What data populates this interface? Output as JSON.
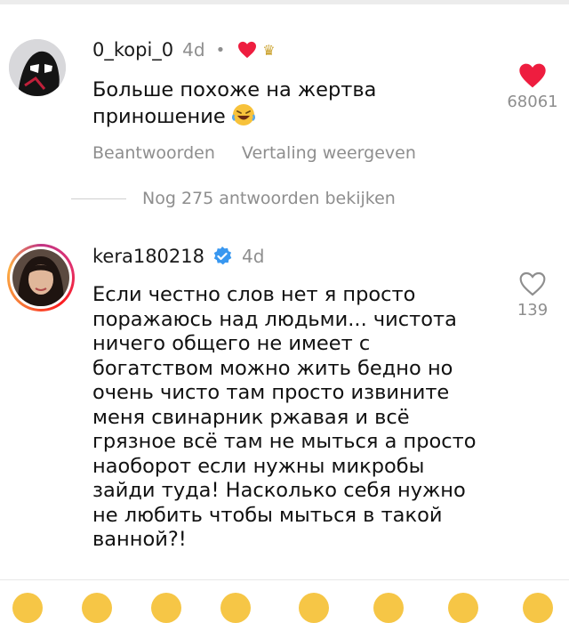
{
  "comments": [
    {
      "username": "0_kopi_0",
      "time": "4d",
      "separator": "•",
      "badge_icon": "crown-icon",
      "text": "Больше похоже на жертва\nприношение",
      "emoji": "laughing-face",
      "like_count": "68061",
      "liked": true,
      "actions": {
        "reply": "Beantwoorden",
        "translate": "Vertaling weergeven"
      },
      "more_replies": "Nog 275 antwoorden bekijken"
    },
    {
      "username": "kera180218",
      "time": "4d",
      "verified": true,
      "text": "Если честно слов нет я просто\nпоражаюсь над людьми... чистота\nничего общего не имеет с\nбогатством можно жить бедно но\nочень чисто там просто извините\nменя свинарник ржавая и всё\nгрязное всё там не мыться а просто\nнаоборот если нужны микробы\nзайди туда! Насколько себя нужно\nне любить чтобы  мыться в такой\nванной?!",
      "like_count": "139",
      "liked": false
    }
  ],
  "colors": {
    "like_red": "#ee1d3f",
    "verified_blue": "#3897f0",
    "muted_gray": "#8e8e8e"
  }
}
